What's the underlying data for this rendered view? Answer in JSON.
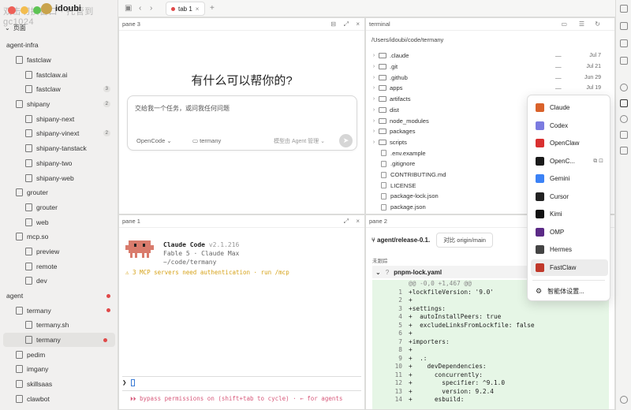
{
  "window": {
    "user": "idoubi",
    "ghost_title": "双击切换窗口 · 托管到 gc1024"
  },
  "sidebar": {
    "header": "页面",
    "items": [
      {
        "label": "agent-infra",
        "level": 0,
        "type": "dir"
      },
      {
        "label": "fastclaw",
        "level": 1,
        "type": "file"
      },
      {
        "label": "fastclaw.ai",
        "level": 2,
        "type": "file"
      },
      {
        "label": "fastclaw",
        "level": 2,
        "type": "file",
        "count": "3"
      },
      {
        "label": "shipany",
        "level": 1,
        "type": "file",
        "count": "2"
      },
      {
        "label": "shipany-next",
        "level": 2,
        "type": "file"
      },
      {
        "label": "shipany-vinext",
        "level": 2,
        "type": "file",
        "count": "2"
      },
      {
        "label": "shipany-tanstack",
        "level": 2,
        "type": "file"
      },
      {
        "label": "shipany-two",
        "level": 2,
        "type": "file"
      },
      {
        "label": "shipany-web",
        "level": 2,
        "type": "file"
      },
      {
        "label": "grouter",
        "level": 1,
        "type": "file"
      },
      {
        "label": "grouter",
        "level": 2,
        "type": "file"
      },
      {
        "label": "web",
        "level": 2,
        "type": "file"
      },
      {
        "label": "mcp.so",
        "level": 1,
        "type": "file"
      },
      {
        "label": "preview",
        "level": 2,
        "type": "file"
      },
      {
        "label": "remote",
        "level": 2,
        "type": "file"
      },
      {
        "label": "dev",
        "level": 2,
        "type": "file"
      },
      {
        "label": "agent",
        "level": 0,
        "type": "dir",
        "dot": true
      },
      {
        "label": "termany",
        "level": 1,
        "type": "file",
        "dot": true
      },
      {
        "label": "termany.sh",
        "level": 2,
        "type": "file"
      },
      {
        "label": "termany",
        "level": 2,
        "type": "file",
        "dot": true,
        "selected": true
      },
      {
        "label": "pedim",
        "level": 1,
        "type": "file"
      },
      {
        "label": "imgany",
        "level": 1,
        "type": "file"
      },
      {
        "label": "skillsaas",
        "level": 1,
        "type": "file"
      },
      {
        "label": "clawbot",
        "level": 1,
        "type": "file"
      }
    ]
  },
  "tabs": [
    {
      "label": "tab 1"
    }
  ],
  "pane3": {
    "title": "pane 3",
    "heading": "有什么可以帮你的?",
    "placeholder": "交给我一个任务，或问我任何问题",
    "agent": "OpenCode",
    "folder": "termany",
    "model": "模型由 Agent 管理"
  },
  "terminal": {
    "title": "terminal",
    "path": "/Users/idoubi/code/termany",
    "files": [
      {
        "name": ".claude",
        "type": "dir",
        "dash": "—",
        "date": "Jul 7"
      },
      {
        "name": ".git",
        "type": "dir",
        "dash": "—",
        "date": "Jul 21"
      },
      {
        "name": ".github",
        "type": "dir",
        "dash": "—",
        "date": "Jun 29"
      },
      {
        "name": "apps",
        "type": "dir",
        "dash": "—",
        "date": "Jul 19"
      },
      {
        "name": "artifacts",
        "type": "dir"
      },
      {
        "name": "dist",
        "type": "dir"
      },
      {
        "name": "node_modules",
        "type": "dir"
      },
      {
        "name": "packages",
        "type": "dir"
      },
      {
        "name": "scripts",
        "type": "dir"
      },
      {
        "name": ".env.example",
        "type": "file"
      },
      {
        "name": ".gitignore",
        "type": "file"
      },
      {
        "name": "CONTRIBUTING.md",
        "type": "file"
      },
      {
        "name": "LICENSE",
        "type": "file"
      },
      {
        "name": "package-lock.json",
        "type": "file"
      },
      {
        "name": "package.json",
        "type": "file"
      }
    ]
  },
  "pane1": {
    "title": "pane 1",
    "app": "Claude Code",
    "version": "v2.1.216",
    "model_line": "Fable 5 · Claude Max",
    "cwd": "~/code/termany",
    "warning": "⚠ 3 MCP servers need authentication · run /mcp",
    "prompt": "❯",
    "status": "⏵⏵ bypass permissions on (shift+tab to cycle) · ← for agents"
  },
  "pane2": {
    "title": "pane 2",
    "branch": "agent/release-0.1.",
    "compare": "对比 origin/main",
    "unstaged": "未跟踪",
    "file": "pnpm-lock.yaml",
    "lines": [
      {
        "n": "",
        "t": "@@ -0,0 +1,467 @@",
        "hunk": true
      },
      {
        "n": "1",
        "t": "+lockfileVersion: '9.0'"
      },
      {
        "n": "2",
        "t": "+"
      },
      {
        "n": "3",
        "t": "+settings:"
      },
      {
        "n": "4",
        "t": "+  autoInstallPeers: true"
      },
      {
        "n": "5",
        "t": "+  excludeLinksFromLockfile: false"
      },
      {
        "n": "6",
        "t": "+"
      },
      {
        "n": "7",
        "t": "+importers:"
      },
      {
        "n": "8",
        "t": "+"
      },
      {
        "n": "9",
        "t": "+  .:"
      },
      {
        "n": "10",
        "t": "+    devDependencies:"
      },
      {
        "n": "11",
        "t": "+      concurrently:"
      },
      {
        "n": "12",
        "t": "+        specifier: ^9.1.0"
      },
      {
        "n": "13",
        "t": "+        version: 9.2.4"
      },
      {
        "n": "14",
        "t": "+      esbuild:"
      }
    ]
  },
  "agent_menu": {
    "items": [
      {
        "label": "Claude",
        "color": "#d9622b"
      },
      {
        "label": "Codex",
        "color": "#7b7be0"
      },
      {
        "label": "OpenClaw",
        "color": "#d93030"
      },
      {
        "label": "OpenC...",
        "color": "#1a1a1a"
      },
      {
        "label": "Gemini",
        "color": "#3b82f6"
      },
      {
        "label": "Cursor",
        "color": "#222222"
      },
      {
        "label": "Kimi",
        "color": "#111111"
      },
      {
        "label": "OMP",
        "color": "#5b2a86"
      },
      {
        "label": "Hermes",
        "color": "#444444"
      },
      {
        "label": "FastClaw",
        "color": "#c0392b",
        "highlighted": true
      }
    ],
    "settings": "智能体设置..."
  }
}
